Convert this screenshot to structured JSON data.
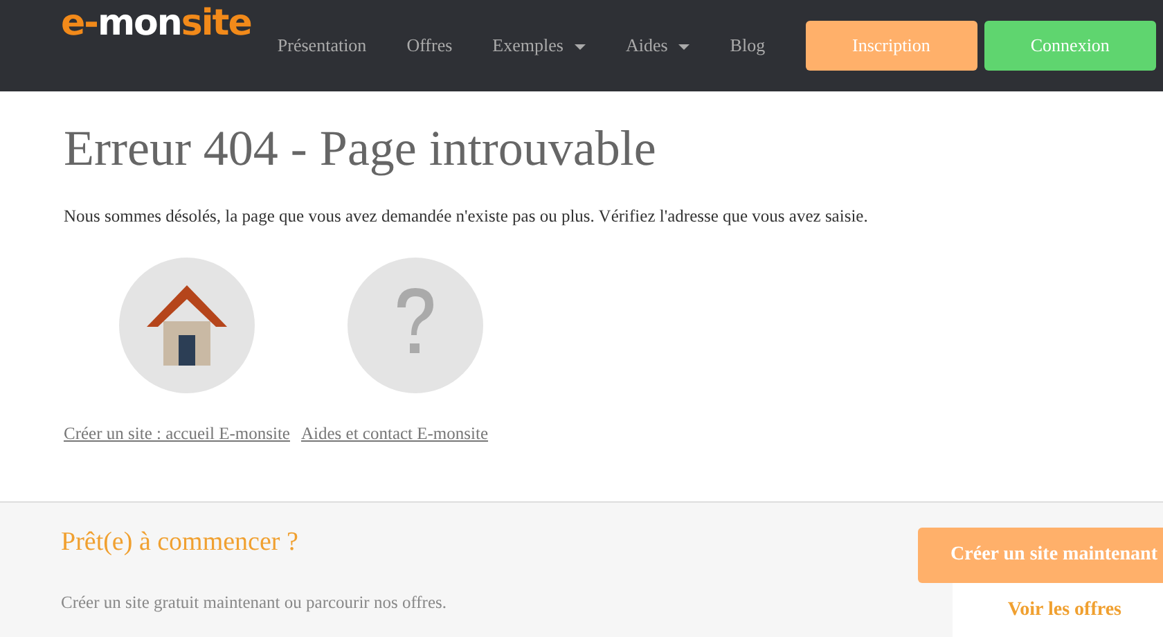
{
  "logo": [
    {
      "text": "e-",
      "color": "#f28a1a"
    },
    {
      "text": "mon",
      "color": "#ffffff"
    },
    {
      "text": "site",
      "color": "#f28a1a"
    }
  ],
  "nav": [
    {
      "label": "Présentation",
      "dropdown": false
    },
    {
      "label": "Offres",
      "dropdown": false
    },
    {
      "label": "Exemples",
      "dropdown": true
    },
    {
      "label": "Aides",
      "dropdown": true
    },
    {
      "label": "Blog",
      "dropdown": false
    }
  ],
  "nav_buttons": [
    {
      "label": "Inscription",
      "color": "#ffb06a"
    },
    {
      "label": "Connexion",
      "color": "#5fd56f"
    }
  ],
  "error": {
    "title": "Erreur 404 - Page introuvable",
    "message": "Nous sommes désolés, la page que vous avez demandée n'existe pas ou plus. Vérifiez l'adresse que vous avez saisie."
  },
  "icons": [
    {
      "kind": "home"
    },
    {
      "kind": "help"
    }
  ],
  "links": [
    "Créer un site : accueil E-monsite",
    "Aides et contact E-monsite"
  ],
  "cta": {
    "title": "Prêt(e) à commencer ?",
    "text": "Créer un site gratuit maintenant ou parcourir nos offres.",
    "buttons": [
      {
        "label": "Créer un site maintenant",
        "kind": "primary"
      },
      {
        "label": "Voir les offres",
        "kind": "secondary"
      }
    ]
  }
}
